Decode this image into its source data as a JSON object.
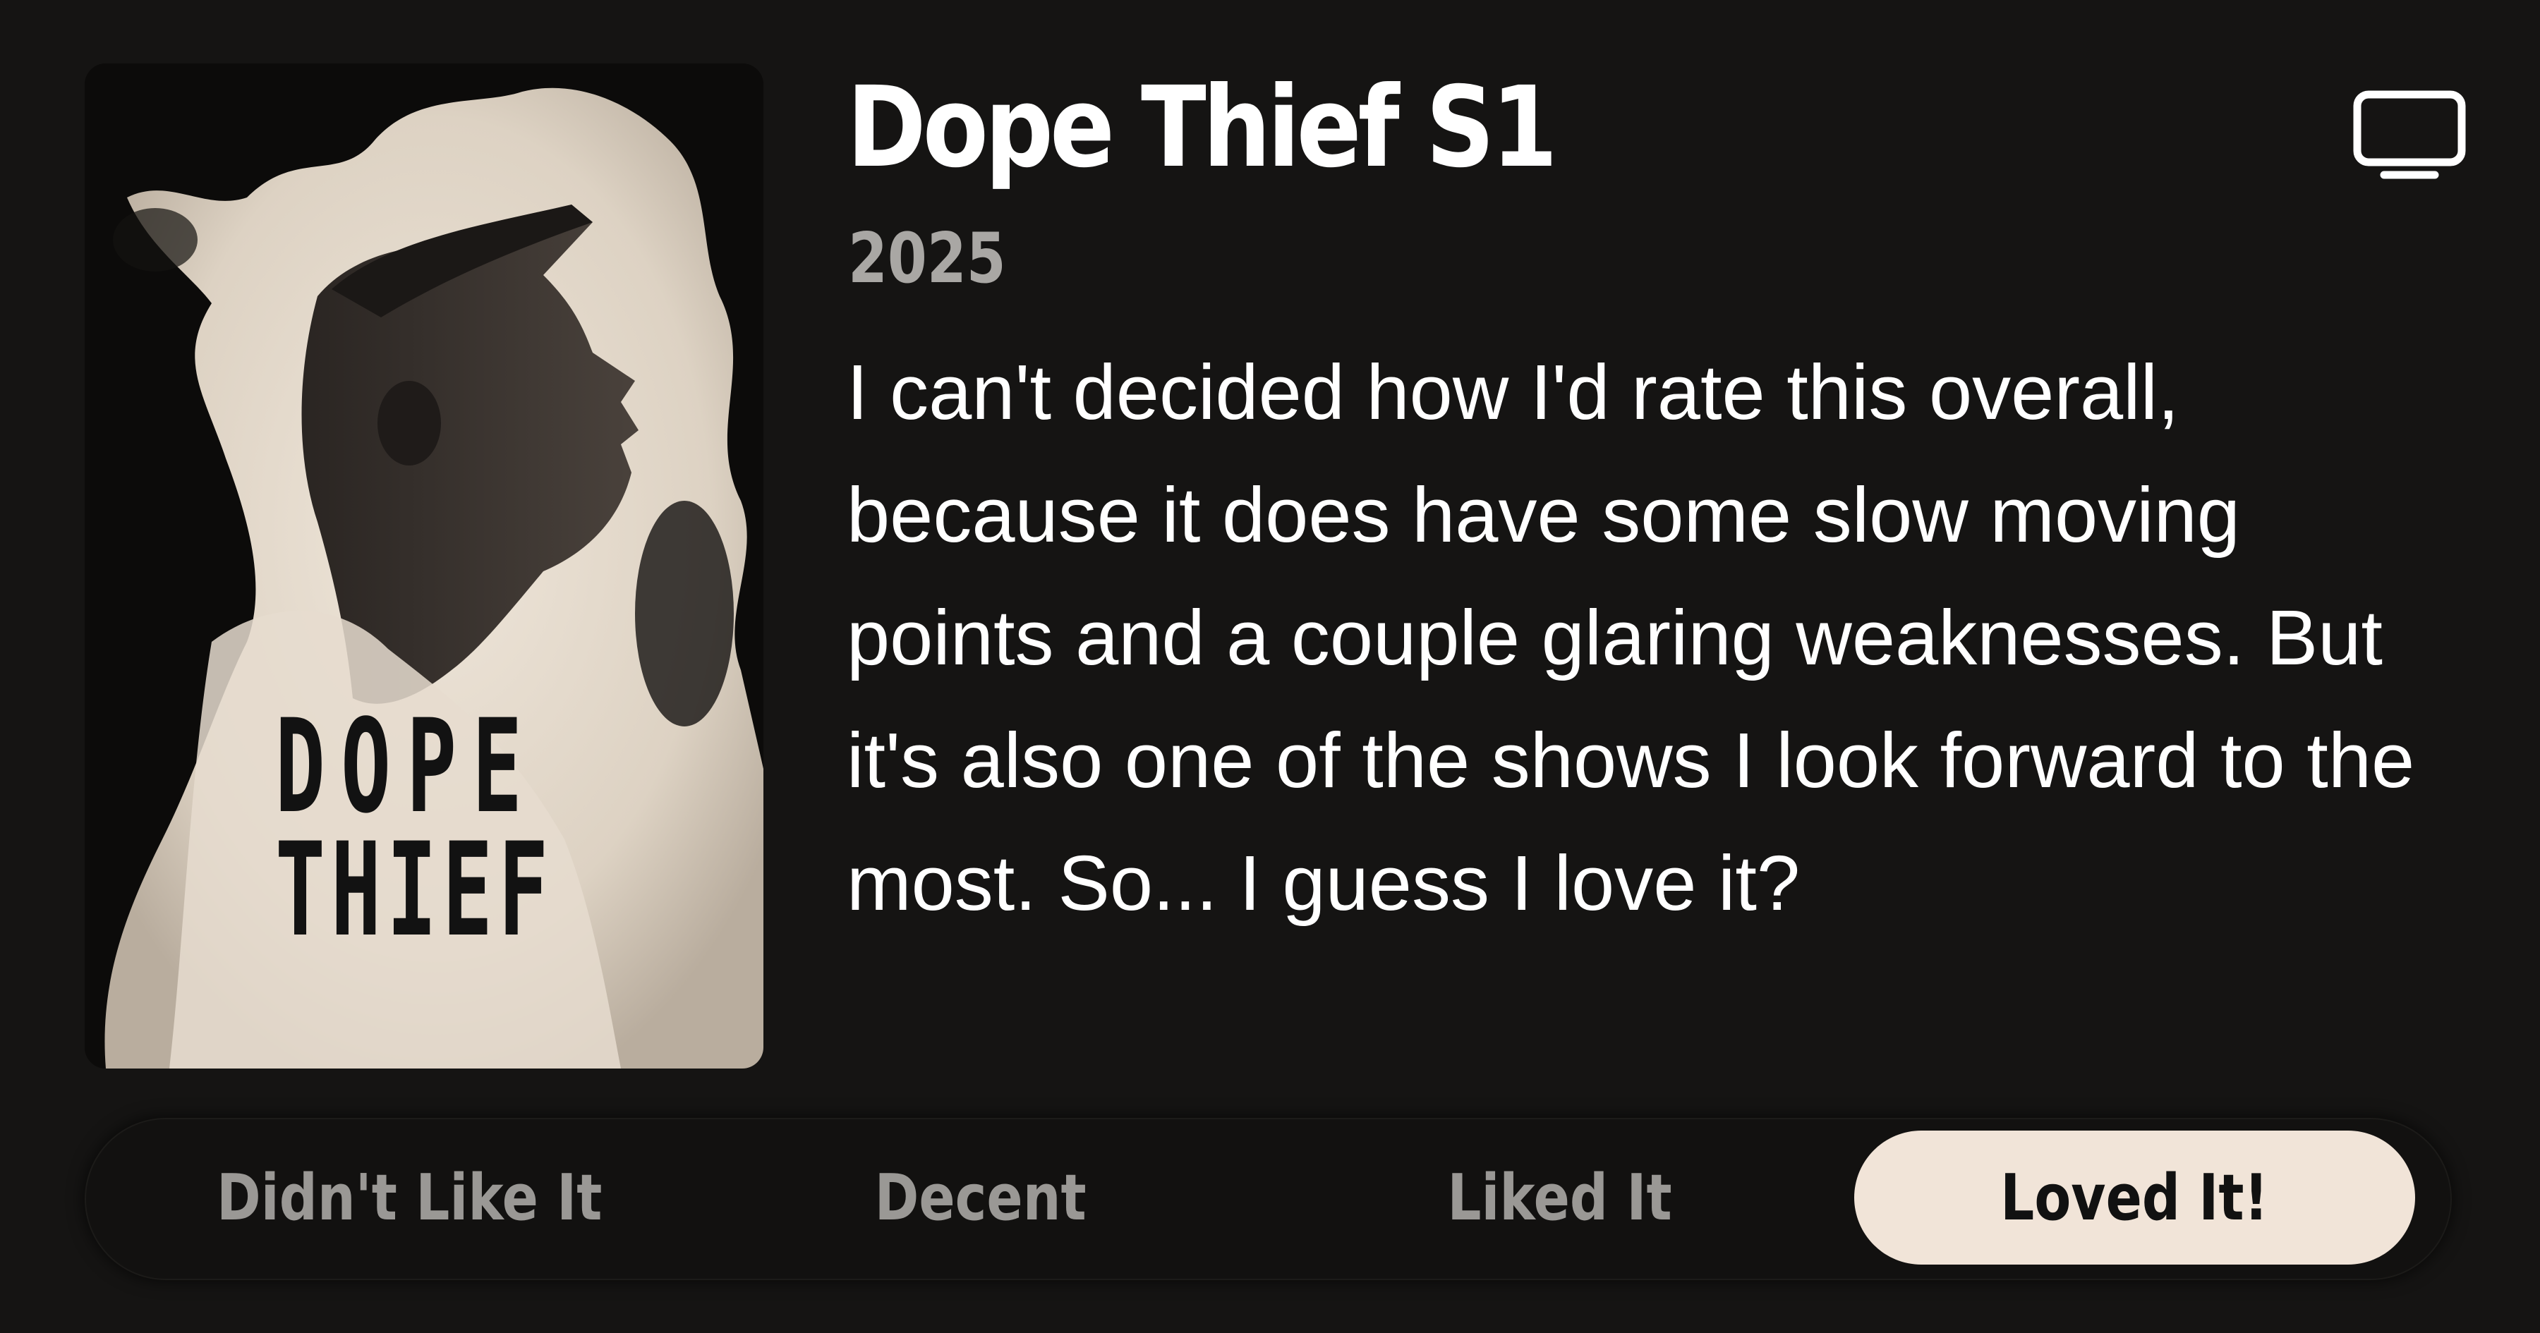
{
  "show": {
    "title": "Dope Thief S1",
    "year": "2025",
    "review": "I can't decided how I'd rate this overall, because it does have some slow moving points and a couple glaring weaknesses. But it's also one of the shows I look forward to the most. So... I guess I love it?"
  },
  "poster": {
    "line1": "DOPE",
    "line2": "THIEF",
    "image": "man-in-cap-profile-double-exposure"
  },
  "header": {
    "media_type_icon": "tv-icon"
  },
  "rating": {
    "options": [
      {
        "label": "Didn't Like It",
        "selected": false
      },
      {
        "label": "Decent",
        "selected": false
      },
      {
        "label": "Liked It",
        "selected": false
      },
      {
        "label": "Loved It!",
        "selected": true
      }
    ],
    "selected_color": "#f1e4d8"
  },
  "colors": {
    "background": "#151413",
    "year_text": "#a9a7a4",
    "unselected_text": "#9a9895"
  }
}
